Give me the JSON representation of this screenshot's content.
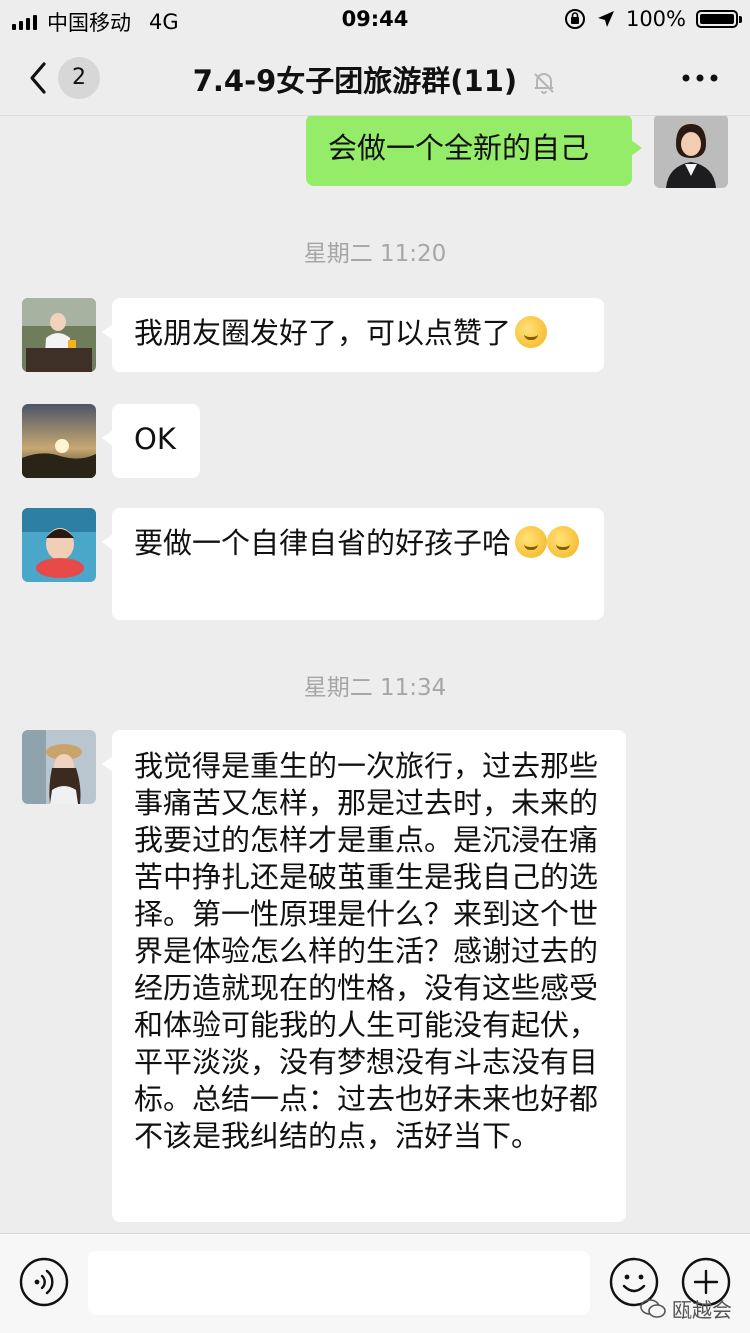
{
  "status_bar": {
    "carrier": "中国移动",
    "network": "4G",
    "time": "09:44",
    "battery": "100%"
  },
  "nav": {
    "unread_count": "2",
    "title": "7.4-9女子团旅游群(11)"
  },
  "messages": [
    {
      "type": "self",
      "text": "会做一个全新的自己"
    },
    {
      "type": "time",
      "text": "星期二 11:20"
    },
    {
      "type": "other",
      "text": "我朋友圈发好了，可以点赞了"
    },
    {
      "type": "other",
      "text": "OK"
    },
    {
      "type": "other",
      "text": "要做一个自律自省的好孩子哈"
    },
    {
      "type": "time",
      "text": "星期二 11:34"
    },
    {
      "type": "other",
      "text": "我觉得是重生的一次旅行，过去那些事痛苦又怎样，那是过去时，未来的我要过的怎样才是重点。是沉浸在痛苦中挣扎还是破茧重生是我自己的选择。第一性原理是什么？来到这个世界是体验怎么样的生活？感谢过去的经历造就现在的性格，没有这些感受和体验可能我的人生可能没有起伏，平平淡淡，没有梦想没有斗志没有目标。总结一点：过去也好未来也好都不该是我纠结的点，活好当下。"
    }
  ],
  "input": {
    "value": ""
  },
  "watermark": "瓯越会",
  "colors": {
    "self_bubble": "#95ec69",
    "other_bubble": "#ffffff",
    "background": "#ededed"
  },
  "icons": [
    "back-icon",
    "mute-bell-icon",
    "more-icon",
    "voice-icon",
    "emoji-icon",
    "plus-icon",
    "laughing-emoji"
  ]
}
